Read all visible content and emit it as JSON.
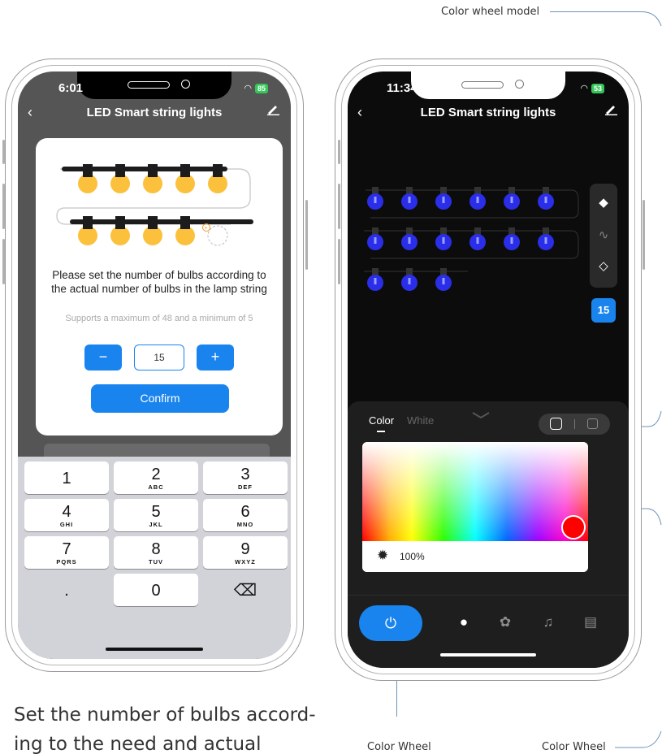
{
  "callouts": {
    "top_right": "Color wheel model",
    "bottom_center": "Color Wheel",
    "bottom_right": "Color Wheel"
  },
  "caption": "Set the number of bulbs accord- ing to the need and actual",
  "left_phone": {
    "status": {
      "time": "6:01",
      "battery": "85"
    },
    "nav": {
      "title": "LED Smart string lights",
      "back_icon": "chevron-left-icon",
      "edit_icon": "pencil-icon"
    },
    "dialog": {
      "message": "Please set the number of bulbs according to the actual number of bulbs in the lamp string",
      "hint": "Supports a maximum of 48 and a minimum of 5",
      "decrement_label": "−",
      "value": "15",
      "increment_label": "+",
      "confirm_label": "Confirm"
    },
    "keyboard": {
      "keys": [
        {
          "num": "1",
          "letters": ""
        },
        {
          "num": "2",
          "letters": "ABC"
        },
        {
          "num": "3",
          "letters": "DEF"
        },
        {
          "num": "4",
          "letters": "GHI"
        },
        {
          "num": "5",
          "letters": "JKL"
        },
        {
          "num": "6",
          "letters": "MNO"
        },
        {
          "num": "7",
          "letters": "PQRS"
        },
        {
          "num": "8",
          "letters": "TUV"
        },
        {
          "num": "9",
          "letters": "WXYZ"
        },
        {
          "num": ".",
          "letters": ""
        },
        {
          "num": "0",
          "letters": ""
        },
        {
          "num": "⌫",
          "letters": ""
        }
      ]
    }
  },
  "right_phone": {
    "status": {
      "time": "11:34",
      "battery": "53"
    },
    "nav": {
      "title": "LED Smart string lights",
      "back_icon": "chevron-left-icon",
      "edit_icon": "pencil-icon"
    },
    "bulb_count_badge": "15",
    "tools": [
      "paint-bucket-icon",
      "brush-icon",
      "eraser-icon"
    ],
    "panel": {
      "tabs": [
        {
          "label": "Color",
          "active": true
        },
        {
          "label": "White",
          "active": false
        }
      ],
      "brightness": "100%",
      "selected_color": "#ff0000"
    },
    "bottom_bar": [
      "power-icon",
      "bulb-icon",
      "palette-icon",
      "music-icon",
      "schedule-icon"
    ]
  },
  "colors": {
    "accent": "#1a84ee",
    "bulb_yellow": "#fbc13c",
    "bulb_blue": "#2b2ee8"
  }
}
